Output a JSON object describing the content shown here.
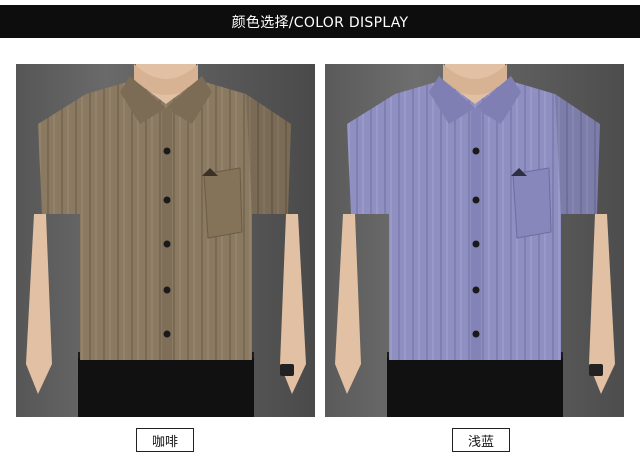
{
  "header": {
    "title": "颜色选择/COLOR DISPLAY"
  },
  "colors": [
    {
      "label": "咖啡",
      "shirt_color": "#8b7a62"
    },
    {
      "label": "浅蓝",
      "shirt_color": "#8f8fc2"
    }
  ],
  "palette": {
    "header_bg": "#0d0d0d",
    "header_text": "#ffffff",
    "backdrop": "#5e5e5e",
    "trousers": "#111111",
    "skin": "#e2c0a4"
  }
}
